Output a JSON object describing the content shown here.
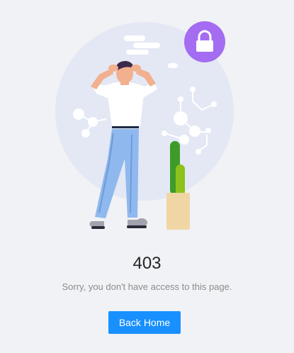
{
  "result": {
    "status_code": "403",
    "sub_title": "Sorry, you don't have access to this page.",
    "back_button_label": "Back Home"
  },
  "illustration": {
    "icons": [
      "lock-icon",
      "cloud-icon",
      "molecule-icon",
      "circuit-icon",
      "cactus-plant",
      "stressed-man"
    ],
    "colors": {
      "background": "#f0f2f5",
      "circle": "#e4e8f4",
      "lock_badge": "#a46cf0",
      "primary_button": "#1890ff",
      "jeans": "#8fb8ee",
      "cactus_dark": "#3e9b2a",
      "cactus_light": "#8cc21a",
      "pot": "#f1d6a5"
    }
  }
}
